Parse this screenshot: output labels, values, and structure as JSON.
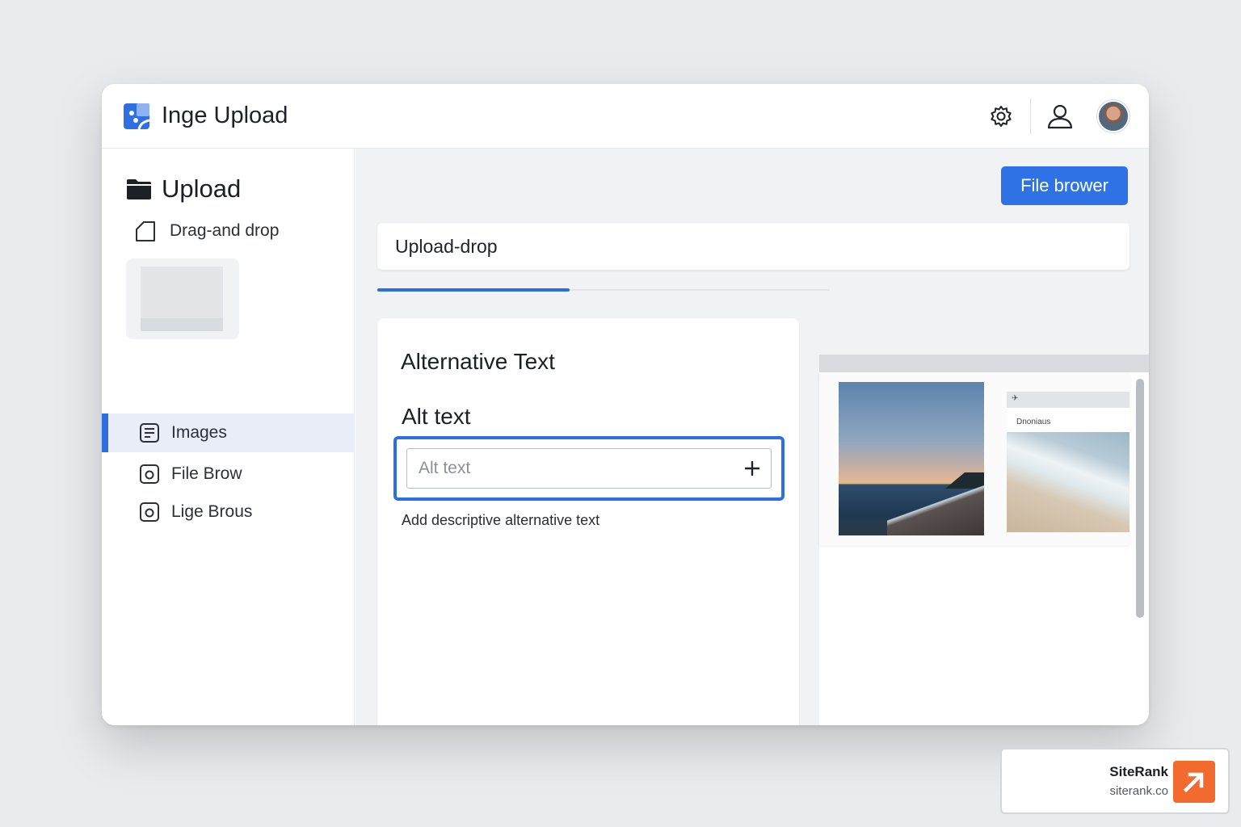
{
  "app": {
    "title": "Inge Upload",
    "accent_color": "#2d6fe0"
  },
  "header": {
    "actions": [
      {
        "icon": "gear-icon"
      },
      {
        "icon": "user-icon"
      },
      {
        "icon": "avatar"
      }
    ]
  },
  "sidebar": {
    "heading": "Upload",
    "subheading": "Drag-and drop",
    "items": [
      {
        "label": "Images",
        "icon": "list-icon",
        "active": true
      },
      {
        "label": "File Brow",
        "icon": "camera-icon",
        "active": false
      },
      {
        "label": "Lige Brous",
        "icon": "camera-icon",
        "active": false
      }
    ]
  },
  "main": {
    "file_browser_button": "File brower",
    "search_value": "Upload-drop",
    "form": {
      "title": "Alternative Text",
      "field_label": "Alt text",
      "field_placeholder": "Alt text",
      "field_value": "",
      "helper": "Add descriptive alternative text"
    },
    "preview": {
      "caption": "Dnoniaus"
    }
  },
  "watermark": {
    "name": "SiteRank",
    "url": "siterank.co",
    "color": "#f26a2e"
  }
}
